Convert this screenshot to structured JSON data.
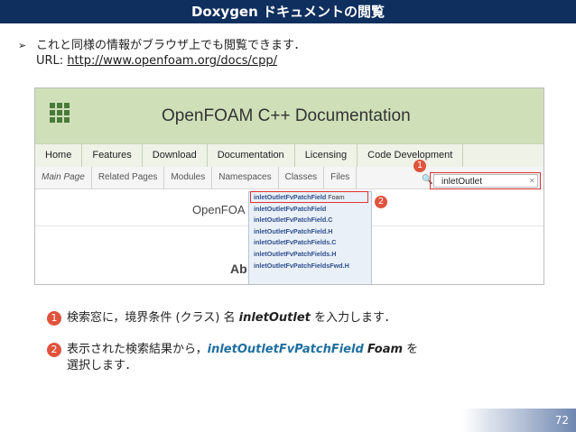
{
  "slide": {
    "title": "Doxygen ドキュメントの閲覧",
    "bullet_icon": "➢",
    "intro_line1": "これと同様の情報がブラウザ上でも閲覧できます．",
    "intro_url_label": "URL: ",
    "intro_url": "http://www.openfoam.org/docs/cpp/",
    "page_number": "72"
  },
  "screenshot": {
    "site_title": "OpenFOAM C++ Documentation",
    "nav_primary": [
      "Home",
      "Features",
      "Download",
      "Documentation",
      "Licensing",
      "Code Development"
    ],
    "nav_secondary": [
      "Main Page",
      "Related Pages",
      "Modules",
      "Namespaces",
      "Classes",
      "Files"
    ],
    "search_value": "inletOutlet",
    "search_icon": "magnifier-icon",
    "clear_icon": "clear-search-icon",
    "page_heading": "OpenFOA",
    "about_heading": "Ab",
    "dropdown": [
      {
        "name": "inletOutletFvPatchField",
        "suffix": " Foam"
      },
      {
        "name": "inletOutletFvPatchField",
        "suffix": ""
      },
      {
        "name": "inletOutletFvPatchField.C",
        "suffix": ""
      },
      {
        "name": "inletOutletFvPatchField.H",
        "suffix": ""
      },
      {
        "name": "inletOutletFvPatchFields.C",
        "suffix": ""
      },
      {
        "name": "inletOutletFvPatchFields.H",
        "suffix": ""
      },
      {
        "name": "inletOutletFvPatchFieldsFwd.H",
        "suffix": ""
      }
    ],
    "marker_1": "1",
    "marker_2": "2"
  },
  "steps": [
    {
      "num": "1",
      "pre": "検索窓に，境界条件 (クラス) 名 ",
      "em": "inletOutlet",
      "post": " を入力します．"
    },
    {
      "num": "2",
      "pre": "表示された検索結果から，",
      "em1": "inletOutletFvPatchField",
      "em2": "Foam",
      "post": " を",
      "line2": "選択します．"
    }
  ],
  "colors": {
    "title_bar": "#0f2f5e",
    "marker": "#e0533c",
    "highlight": "#dd3333",
    "link_blue": "#1f6fa0"
  }
}
